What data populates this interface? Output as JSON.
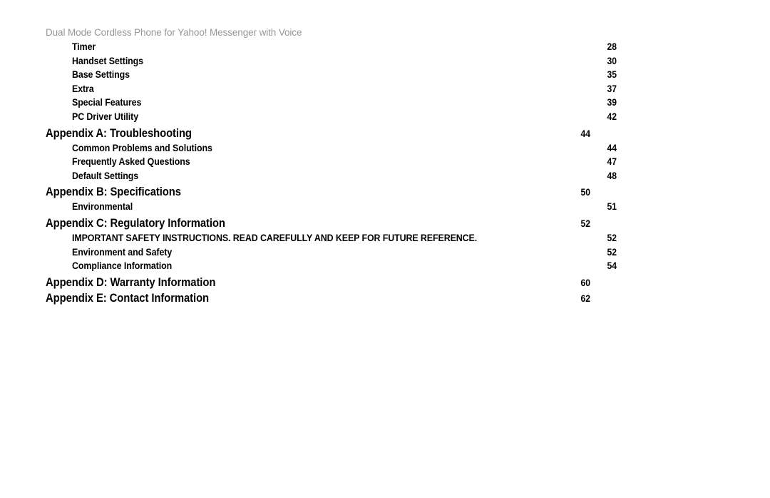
{
  "header": {
    "running_head": "Dual Mode Cordless Phone for Yahoo! Messenger with Voice",
    "color": "#969696"
  },
  "toc": {
    "entries": [
      {
        "level": 2,
        "title": "Timer",
        "page": "28"
      },
      {
        "level": 2,
        "title": "Handset Settings",
        "page": "30"
      },
      {
        "level": 2,
        "title": "Base Settings",
        "page": "35"
      },
      {
        "level": 2,
        "title": "Extra",
        "page": "37"
      },
      {
        "level": 2,
        "title": "Special Features",
        "page": "39"
      },
      {
        "level": 2,
        "title": "PC Driver Utility",
        "page": "42"
      },
      {
        "level": 1,
        "title": "Appendix A: Troubleshooting",
        "page": "44"
      },
      {
        "level": 2,
        "title": "Common Problems and Solutions",
        "page": "44"
      },
      {
        "level": 2,
        "title": "Frequently Asked Questions",
        "page": "47"
      },
      {
        "level": 2,
        "title": "Default Settings",
        "page": "48"
      },
      {
        "level": 1,
        "title": "Appendix B: Specifications",
        "page": "50"
      },
      {
        "level": 2,
        "title": "Environmental",
        "page": "51"
      },
      {
        "level": 1,
        "title": "Appendix C: Regulatory Information",
        "page": "52"
      },
      {
        "level": 2,
        "title": "IMPORTANT SAFETY INSTRUCTIONS. READ CAREFULLY AND KEEP FOR FUTURE REFERENCE.",
        "page": "52"
      },
      {
        "level": 2,
        "title": "Environment and Safety",
        "page": "52"
      },
      {
        "level": 2,
        "title": "Compliance Information",
        "page": "54"
      },
      {
        "level": 1,
        "title": "Appendix D: Warranty Information",
        "page": "60"
      },
      {
        "level": 1,
        "title": "Appendix E: Contact Information",
        "page": "62"
      }
    ]
  }
}
